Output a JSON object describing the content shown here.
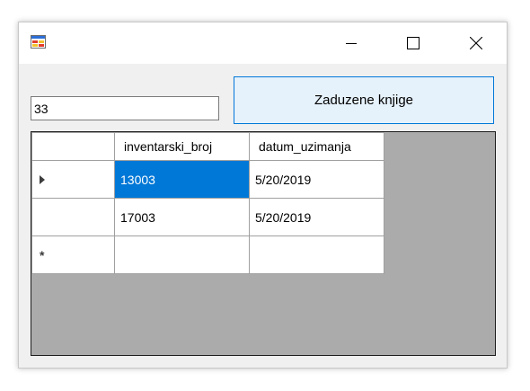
{
  "window": {
    "title": "",
    "accent": "#0078d7"
  },
  "form": {
    "input_value": "33",
    "button_label": "Zaduzene knjige"
  },
  "grid": {
    "columns": [
      "inventarski_broj",
      "datum_uzimanja"
    ],
    "rows": [
      {
        "inventarski_broj": "13003",
        "datum_uzimanja": "5/20/2019",
        "current": true,
        "selected_cell": "inventarski_broj"
      },
      {
        "inventarski_broj": "17003",
        "datum_uzimanja": "5/20/2019"
      },
      {
        "inventarski_broj": "",
        "datum_uzimanja": "",
        "new_row": true
      }
    ]
  },
  "icons": {
    "app": "winforms-app-icon",
    "minimize": "minimize-icon",
    "maximize": "maximize-icon",
    "close": "close-icon",
    "current_row": "current-row-arrow-icon",
    "new_row": "new-row-asterisk-icon"
  }
}
